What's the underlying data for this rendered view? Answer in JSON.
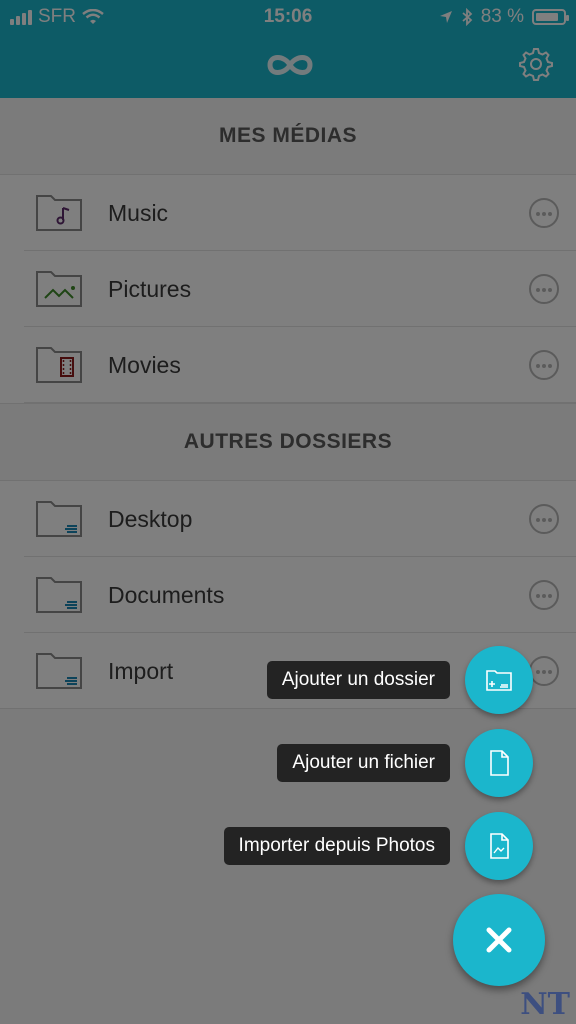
{
  "status_bar": {
    "carrier": "SFR",
    "time": "15:06",
    "battery": "83 %",
    "battery_level": 0.83
  },
  "header": {
    "logo_icon": "infinity-icon",
    "settings_icon": "gear-icon"
  },
  "sections": [
    {
      "title": "MES MÉDIAS",
      "items": [
        {
          "label": "Music",
          "icon": "music-folder-icon"
        },
        {
          "label": "Pictures",
          "icon": "pictures-folder-icon"
        },
        {
          "label": "Movies",
          "icon": "movies-folder-icon"
        }
      ]
    },
    {
      "title": "AUTRES DOSSIERS",
      "items": [
        {
          "label": "Desktop",
          "icon": "folder-icon"
        },
        {
          "label": "Documents",
          "icon": "folder-icon"
        },
        {
          "label": "Import",
          "icon": "folder-icon"
        }
      ]
    }
  ],
  "fab_menu": {
    "add_folder": "Ajouter un dossier",
    "add_file": "Ajouter un fichier",
    "import_photos": "Importer depuis Photos",
    "close_icon": "close-icon"
  },
  "colors": {
    "accent": "#1bb6cc",
    "tooltip_bg": "#232323"
  },
  "watermark": "NT"
}
